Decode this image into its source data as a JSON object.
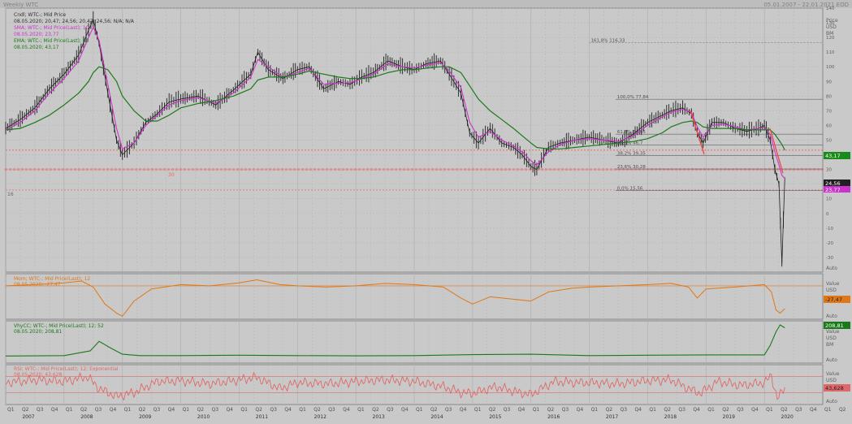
{
  "header": {
    "title": "Weekly WTC",
    "date_range": "05.01.2007 - 22.01.2021 EOD"
  },
  "colors": {
    "bg": "#c9c9c9",
    "grid": "#b0b0b0",
    "price": "#202020",
    "sma": "#cc33cc",
    "ema": "#1a7a1a",
    "mom": "#e07818",
    "vhfcc": "#1a7a1a",
    "rsi": "#e06868",
    "level": "#ee6666",
    "fib": "#606060"
  },
  "legend": {
    "candle_name": "Cndl; WTC-; Mid Price",
    "candle_vals": "08.05.2020; 20,47; 24,56; 20,47; 24,56; N/A; N/A",
    "sma_name": "SMA; WTC-; Mid Price(Last); 10",
    "sma_val": "08.05.2020; 23,77",
    "ema_name": "EMA; WTC-; Mid Price(Last); 40",
    "ema_val": "08.05.2020; 43,17",
    "mom_name": "Mom; WTC-; Mid Price(Last); 12",
    "mom_val": "08.05.2020; -27,47",
    "vhfcc_name": "VhyCC; WTC-; Mid Price(Last); 12; 52",
    "vhfcc_val": "08.05.2020; 208,81",
    "rsi_name": "RSI; WTC-; Mid Price(Last); 12; Exponential",
    "rsi_val": "08.05.2020; 43,628"
  },
  "axis_units": {
    "main": [
      "Price",
      "USD",
      "BM"
    ],
    "mom": [
      "Value",
      "USD"
    ],
    "vhfcc": [
      "Value",
      "USD",
      "BM"
    ],
    "rsi": [
      "Value",
      "USD",
      "BM"
    ],
    "auto": "Auto"
  },
  "badges": {
    "ema": "43,17",
    "price": "24,56",
    "sma": "23,77",
    "mom": "-27,47",
    "vhfcc": "208,81",
    "rsi": "43,628"
  },
  "levels": {
    "label_30": "30",
    "label_16": "16"
  },
  "fibonacci": [
    {
      "label": "161,8%",
      "value": "116,33"
    },
    {
      "label": "100,0%",
      "value": "77,84"
    },
    {
      "label": "61,8%",
      "value": "54,05"
    },
    {
      "label": "50,0%",
      "value": "46,7"
    },
    {
      "label": "38,2%",
      "value": "39,35"
    },
    {
      "label": "23,6%",
      "value": "30,28"
    },
    {
      "label": "0,0%",
      "value": "15,56"
    }
  ],
  "chart_data": {
    "type": "line",
    "x_years": [
      "2007",
      "2008",
      "2009",
      "2010",
      "2011",
      "2012",
      "2013",
      "2014",
      "2015",
      "2016",
      "2017",
      "2018",
      "2019",
      "2020"
    ],
    "x_quarters": [
      "Q1",
      "Q2",
      "Q3",
      "Q4"
    ],
    "main_panel": {
      "ylim": [
        -40,
        140
      ],
      "yticks": [
        140,
        130,
        120,
        110,
        100,
        90,
        80,
        70,
        60,
        50,
        40,
        30,
        20,
        10,
        0,
        -10,
        -20,
        -30
      ],
      "price_x": [
        2007.0,
        2007.25,
        2007.5,
        2007.75,
        2008.0,
        2008.25,
        2008.42,
        2008.5,
        2008.6,
        2008.75,
        2008.9,
        2009.0,
        2009.2,
        2009.4,
        2009.6,
        2009.8,
        2010.0,
        2010.3,
        2010.6,
        2010.9,
        2011.2,
        2011.32,
        2011.5,
        2011.75,
        2012.0,
        2012.2,
        2012.45,
        2012.7,
        2012.9,
        2013.1,
        2013.3,
        2013.55,
        2013.8,
        2014.0,
        2014.2,
        2014.45,
        2014.6,
        2014.8,
        2014.95,
        2015.1,
        2015.3,
        2015.5,
        2015.7,
        2015.85,
        2016.0,
        2016.1,
        2016.3,
        2016.5,
        2016.75,
        2017.0,
        2017.25,
        2017.5,
        2017.75,
        2018.0,
        2018.25,
        2018.4,
        2018.6,
        2018.75,
        2018.85,
        2018.95,
        2019.1,
        2019.3,
        2019.5,
        2019.7,
        2019.9,
        2020.0,
        2020.1,
        2020.18,
        2020.25,
        2020.3,
        2020.35
      ],
      "price": [
        58,
        64,
        72,
        85,
        95,
        108,
        125,
        132,
        116,
        82,
        50,
        40,
        48,
        62,
        68,
        76,
        78,
        80,
        74,
        84,
        95,
        110,
        98,
        92,
        98,
        100,
        85,
        90,
        88,
        93,
        96,
        104,
        100,
        98,
        102,
        104,
        95,
        82,
        55,
        48,
        58,
        48,
        45,
        40,
        32,
        30,
        45,
        48,
        50,
        52,
        50,
        48,
        54,
        62,
        67,
        70,
        72,
        68,
        55,
        48,
        62,
        62,
        58,
        56,
        58,
        60,
        50,
        30,
        20,
        -34,
        24.56
      ],
      "sma": [
        57,
        62,
        70,
        82,
        92,
        104,
        120,
        127,
        118,
        88,
        58,
        44,
        48,
        60,
        67,
        74,
        77,
        79,
        75,
        82,
        93,
        105,
        100,
        93,
        96,
        99,
        88,
        89,
        89,
        92,
        95,
        102,
        100,
        99,
        101,
        103,
        97,
        86,
        62,
        52,
        56,
        50,
        46,
        42,
        36,
        33,
        42,
        47,
        50,
        51,
        50,
        49,
        53,
        60,
        66,
        69,
        71,
        69,
        59,
        52,
        60,
        61,
        59,
        57,
        58,
        59,
        54,
        42,
        33,
        26,
        23.77
      ],
      "ema": [
        57,
        58,
        62,
        67,
        74,
        82,
        90,
        96,
        100,
        98,
        90,
        80,
        70,
        63,
        63,
        67,
        72,
        75,
        77,
        80,
        85,
        91,
        93,
        93,
        95,
        97,
        95,
        93,
        92,
        92,
        93,
        96,
        98,
        98,
        99,
        100,
        100,
        96,
        87,
        78,
        70,
        64,
        58,
        53,
        48,
        45,
        44,
        44,
        45,
        46,
        47,
        48,
        49,
        51,
        55,
        59,
        62,
        63,
        62,
        59,
        58,
        58,
        58,
        57,
        57,
        57,
        57,
        54,
        50,
        47,
        43.17
      ],
      "fib_levels": [
        116.33,
        77.84,
        54.05,
        46.7,
        39.35,
        30.28,
        15.56
      ],
      "red_levels": [
        43.17,
        30,
        16
      ]
    },
    "mom_panel": {
      "ylim": [
        -45,
        30
      ],
      "mid_line": 10,
      "x": [
        2007.0,
        2007.5,
        2008.0,
        2008.3,
        2008.5,
        2008.7,
        2008.9,
        2009.0,
        2009.2,
        2009.5,
        2010.0,
        2010.5,
        2011.0,
        2011.3,
        2011.7,
        2012.0,
        2012.5,
        2013.0,
        2013.5,
        2014.0,
        2014.5,
        2014.8,
        2015.0,
        2015.3,
        2015.7,
        2016.0,
        2016.3,
        2016.7,
        2017.0,
        2017.5,
        2018.0,
        2018.4,
        2018.7,
        2018.85,
        2019.0,
        2019.5,
        2020.0,
        2020.12,
        2020.2,
        2020.27,
        2020.35
      ],
      "values": [
        10,
        12,
        15,
        18,
        8,
        -20,
        -35,
        -40,
        -15,
        5,
        12,
        10,
        15,
        20,
        12,
        10,
        8,
        10,
        14,
        12,
        8,
        -10,
        -20,
        -8,
        -12,
        -15,
        0,
        6,
        8,
        10,
        12,
        14,
        8,
        -10,
        5,
        8,
        12,
        0,
        -30,
        -35,
        -27.47
      ]
    },
    "vhfcc_panel": {
      "ylim": [
        -50,
        260
      ],
      "x": [
        2007.0,
        2008.0,
        2008.45,
        2008.6,
        2008.8,
        2009.0,
        2009.3,
        2010.0,
        2011.0,
        2012.0,
        2013.0,
        2014.0,
        2015.0,
        2016.0,
        2017.0,
        2018.0,
        2019.0,
        2020.0,
        2020.1,
        2020.2,
        2020.27,
        2020.35
      ],
      "values": [
        2,
        5,
        40,
        110,
        60,
        15,
        5,
        5,
        8,
        5,
        3,
        5,
        12,
        15,
        5,
        8,
        10,
        10,
        80,
        180,
        230,
        208.81
      ]
    },
    "rsi_panel": {
      "ylim": [
        0,
        100
      ],
      "levels": [
        70,
        30
      ],
      "x": [
        2007.0,
        2007.5,
        2008.0,
        2008.4,
        2008.6,
        2008.9,
        2009.2,
        2009.6,
        2010.0,
        2010.5,
        2011.0,
        2011.3,
        2011.7,
        2012.0,
        2012.5,
        2013.0,
        2013.5,
        2014.0,
        2014.5,
        2014.8,
        2015.0,
        2015.4,
        2015.8,
        2016.0,
        2016.4,
        2016.8,
        2017.0,
        2017.5,
        2018.0,
        2018.4,
        2018.7,
        2018.9,
        2019.2,
        2019.6,
        2020.0,
        2020.12,
        2020.22,
        2020.3,
        2020.35
      ],
      "values": [
        55,
        62,
        58,
        70,
        40,
        20,
        30,
        58,
        60,
        52,
        62,
        68,
        40,
        55,
        52,
        58,
        62,
        58,
        45,
        30,
        28,
        45,
        30,
        25,
        58,
        55,
        55,
        52,
        60,
        62,
        40,
        28,
        58,
        48,
        55,
        72,
        15,
        30,
        43.628
      ]
    }
  }
}
